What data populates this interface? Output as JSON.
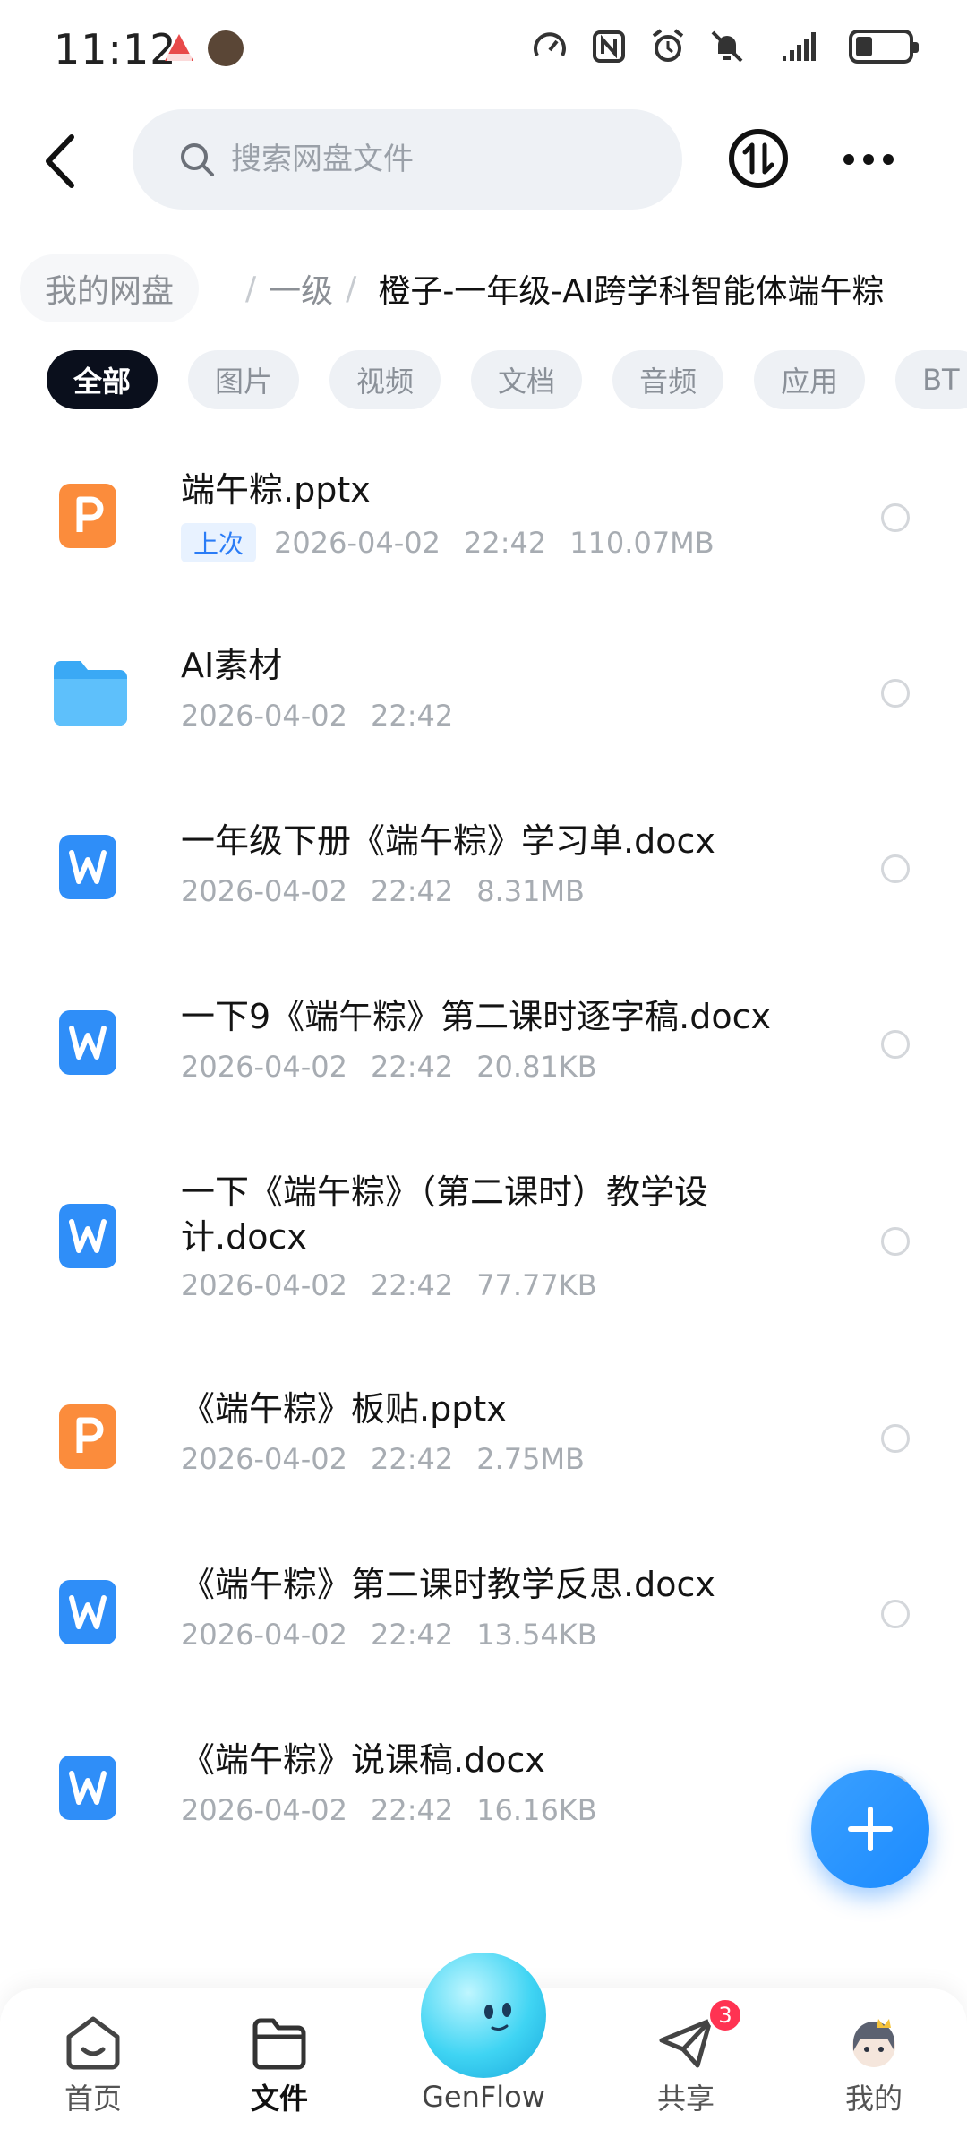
{
  "status_bar": {
    "time": "11:12",
    "icons": [
      "speed-icon",
      "nfc-icon",
      "alarm-icon",
      "mute-icon",
      "signal-icon",
      "battery-icon"
    ]
  },
  "header": {
    "search_placeholder": "搜索网盘文件"
  },
  "breadcrumb": {
    "root": "我的网盘",
    "level1": "一级",
    "current": "橙子-一年级-AI跨学科智能体端午粽"
  },
  "filters": [
    "全部",
    "图片",
    "视频",
    "文档",
    "音频",
    "应用",
    "BT"
  ],
  "files": [
    {
      "name": "端午粽.pptx",
      "type": "pptx",
      "tag": "上次",
      "date": "2026-04-02",
      "time": "22:42",
      "size": "110.07MB"
    },
    {
      "name": "AI素材",
      "type": "folder",
      "date": "2026-04-02",
      "time": "22:42",
      "size": ""
    },
    {
      "name": "一年级下册《端午粽》学习单.docx",
      "type": "docx",
      "date": "2026-04-02",
      "time": "22:42",
      "size": "8.31MB"
    },
    {
      "name": "一下9《端午粽》第二课时逐字稿.docx",
      "type": "docx",
      "date": "2026-04-02",
      "time": "22:42",
      "size": "20.81KB"
    },
    {
      "name": "一下《端午粽》（第二课时）教学设计.docx",
      "type": "docx",
      "date": "2026-04-02",
      "time": "22:42",
      "size": "77.77KB"
    },
    {
      "name": "《端午粽》板贴.pptx",
      "type": "pptx",
      "date": "2026-04-02",
      "time": "22:42",
      "size": "2.75MB"
    },
    {
      "name": "《端午粽》第二课时教学反思.docx",
      "type": "docx",
      "date": "2026-04-02",
      "time": "22:42",
      "size": "13.54KB"
    },
    {
      "name": "《端午粽》说课稿.docx",
      "type": "docx",
      "date": "2026-04-02",
      "time": "22:42",
      "size": "16.16KB"
    }
  ],
  "bottom_nav": {
    "home": "首页",
    "files": "文件",
    "genflow": "GenFlow",
    "share": "共享",
    "share_badge": "3",
    "mine": "我的"
  },
  "colors": {
    "accent": "#2a7cf6",
    "pptx": "#fb8c3c",
    "docx": "#2f8ef8",
    "folder": "#3aa9f5",
    "chip_active": "#0a0f1c"
  }
}
